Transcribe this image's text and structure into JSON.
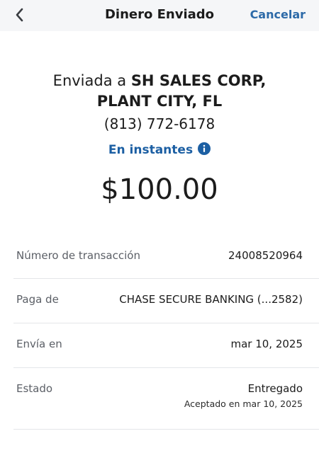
{
  "header": {
    "title": "Dinero Enviado",
    "cancel_label": "Cancelar"
  },
  "recipient": {
    "prefix": "Enviada a ",
    "name": "SH SALES CORP, PLANT CITY, FL",
    "phone": "(813) 772-6178"
  },
  "speed": {
    "label": "En instantes",
    "icon": "info-icon"
  },
  "amount": "$100.00",
  "details": [
    {
      "label": "Número de transacción",
      "value": "24008520964"
    },
    {
      "label": "Paga de",
      "value": "CHASE SECURE BANKING (...2582)"
    },
    {
      "label": "Envía en",
      "value": "mar 10, 2025"
    },
    {
      "label": "Estado",
      "value": "Entregado",
      "subvalue": "Aceptado en mar 10, 2025"
    }
  ],
  "colors": {
    "accent": "#1c5fa3",
    "header_bg": "#f5f6f8"
  }
}
